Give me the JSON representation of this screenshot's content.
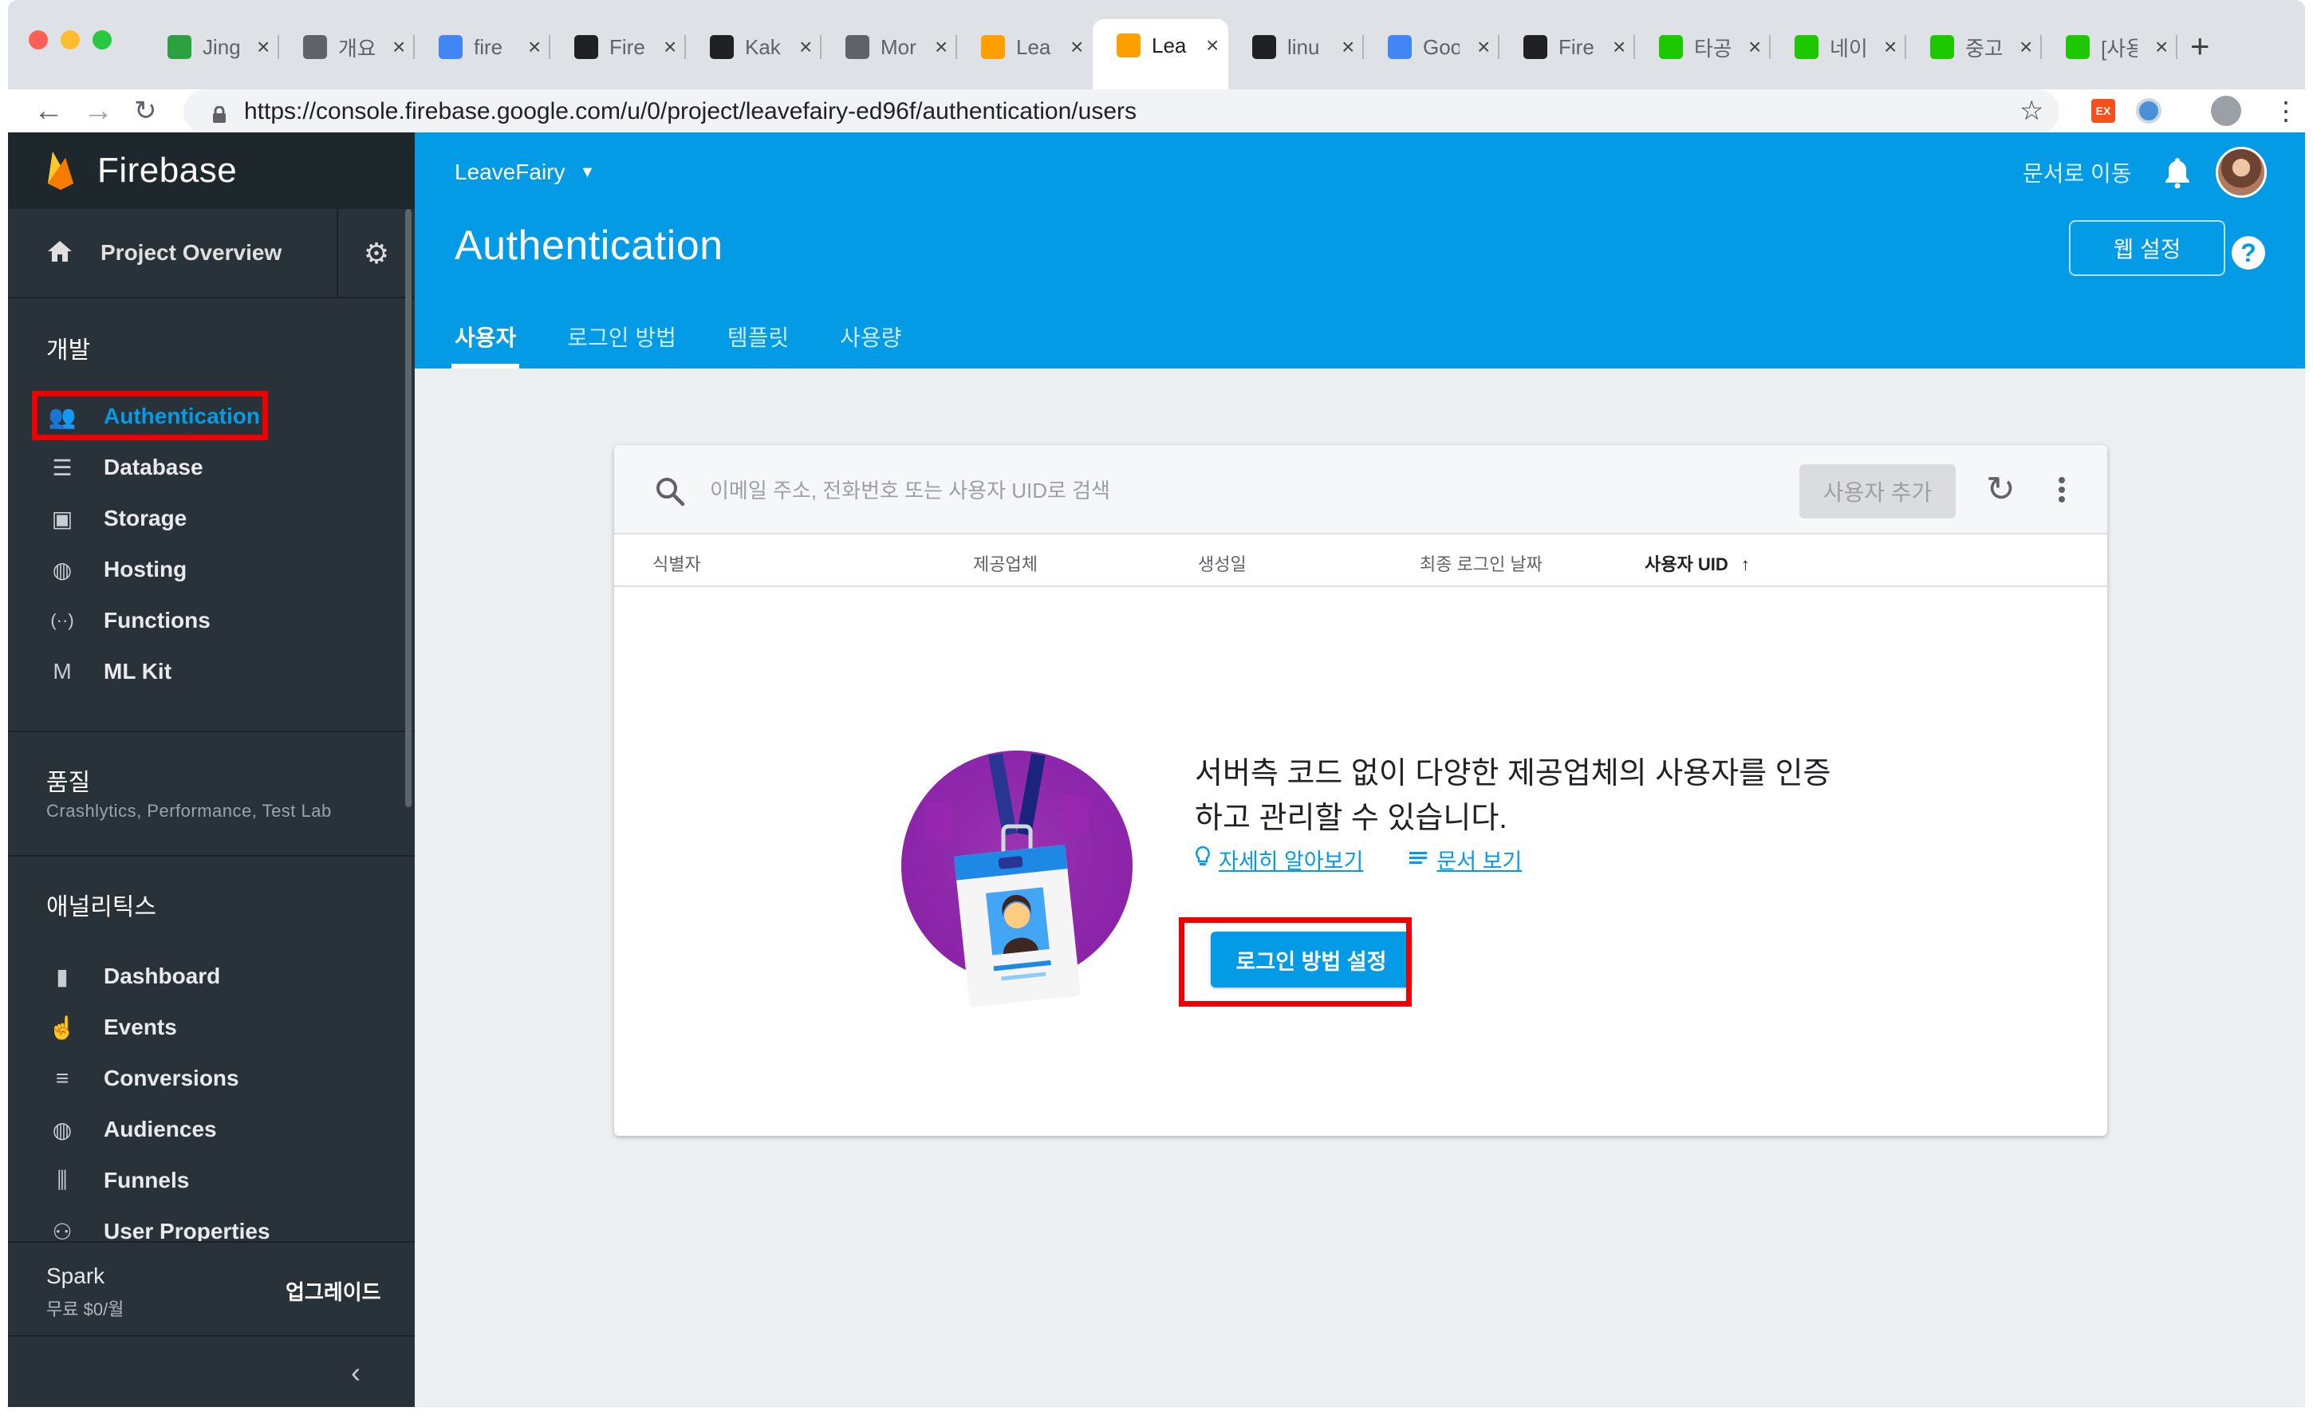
{
  "browser": {
    "tabs": [
      {
        "title": "Jing",
        "icon": "jing-favicon-icon",
        "color": "#2da042"
      },
      {
        "title": "개요",
        "icon": "translate-favicon-icon",
        "color": "#5f6368"
      },
      {
        "title": "fire",
        "icon": "google-favicon-icon",
        "color": "#4285f4"
      },
      {
        "title": "Fire",
        "icon": "cursor-favicon-icon",
        "color": "#202124"
      },
      {
        "title": "Kak",
        "icon": "kakao-favicon-icon",
        "color": "#202124"
      },
      {
        "title": "Mor",
        "icon": "document-favicon-icon",
        "color": "#5f6368"
      },
      {
        "title": "Lea",
        "icon": "firebase-favicon-icon",
        "color": "#ffa000"
      },
      {
        "title": "Lea",
        "icon": "firebase-favicon-icon",
        "color": "#ffa000"
      },
      {
        "title": "linu",
        "icon": "linux-favicon-icon",
        "color": "#202124"
      },
      {
        "title": "Goo",
        "icon": "google-favicon-icon",
        "color": "#4285f4"
      },
      {
        "title": "Fire",
        "icon": "cursor-favicon-icon",
        "color": "#202124"
      },
      {
        "title": "타공",
        "icon": "naver-favicon-icon",
        "color": "#1ec800"
      },
      {
        "title": "네이",
        "icon": "naver-cafe-favicon-icon",
        "color": "#1ec800"
      },
      {
        "title": "중고",
        "icon": "naver-cafe-favicon-icon",
        "color": "#1ec800"
      },
      {
        "title": "[사용",
        "icon": "naver-cafe-favicon-icon",
        "color": "#1ec800"
      }
    ],
    "new_tab": "+",
    "url": "https://console.firebase.google.com/u/0/project/leavefairy-ed96f/authentication/users"
  },
  "sidebar": {
    "brand": "Firebase",
    "overview": "Project Overview",
    "sections": {
      "develop": "개발",
      "quality": "품질",
      "quality_sub": "Crashlytics, Performance, Test Lab",
      "analytics": "애널리틱스"
    },
    "develop_items": [
      {
        "label": "Authentication",
        "icon": "users-icon",
        "active": true
      },
      {
        "label": "Database",
        "icon": "database-icon"
      },
      {
        "label": "Storage",
        "icon": "storage-icon"
      },
      {
        "label": "Hosting",
        "icon": "globe-icon"
      },
      {
        "label": "Functions",
        "icon": "functions-icon"
      },
      {
        "label": "ML Kit",
        "icon": "ml-kit-icon"
      }
    ],
    "analytics_items": [
      {
        "label": "Dashboard",
        "icon": "bar-chart-icon"
      },
      {
        "label": "Events",
        "icon": "touch-icon"
      },
      {
        "label": "Conversions",
        "icon": "conversions-icon"
      },
      {
        "label": "Audiences",
        "icon": "globe-icon"
      },
      {
        "label": "Funnels",
        "icon": "funnel-icon"
      },
      {
        "label": "User Properties",
        "icon": "user-properties-icon"
      }
    ],
    "plan": {
      "name": "Spark",
      "price": "무료 $0/월",
      "upgrade": "업그레이드"
    }
  },
  "header": {
    "project": "LeaveFairy",
    "title": "Authentication",
    "docs_link": "문서로 이동",
    "web_setup": "웹 설정",
    "help": "?",
    "tabs": [
      "사용자",
      "로그인 방법",
      "템플릿",
      "사용량"
    ]
  },
  "users_card": {
    "search_placeholder": "이메일 주소, 전화번호 또는 사용자 UID로 검색",
    "add_user": "사용자 추가",
    "columns": [
      "식별자",
      "제공업체",
      "생성일",
      "최종 로그인 날짜",
      "사용자 UID"
    ],
    "empty_message": "서버측 코드 없이 다양한 제공업체의 사용자를 인증하고 관리할 수 있습니다.",
    "learn_more": "자세히 알아보기",
    "view_docs": "문서 보기",
    "setup_signin": "로그인 방법 설정"
  },
  "colors": {
    "accent": "#039be5",
    "sidebar_bg": "#283238",
    "highlight": "#ee0000"
  }
}
